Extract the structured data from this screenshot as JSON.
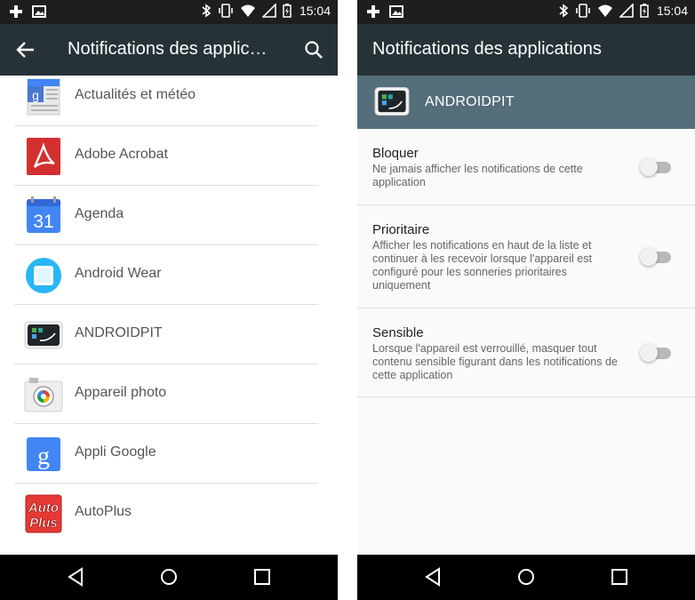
{
  "status_bar": {
    "time": "15:04"
  },
  "left_screen": {
    "title": "Notifications des applic…",
    "apps": [
      {
        "label": "Actualités et météo",
        "icon": "news-weather-icon"
      },
      {
        "label": "Adobe Acrobat",
        "icon": "adobe-acrobat-icon"
      },
      {
        "label": "Agenda",
        "icon": "calendar-icon",
        "icon_text": "31"
      },
      {
        "label": "Android Wear",
        "icon": "android-wear-icon"
      },
      {
        "label": "ANDROIDPIT",
        "icon": "androidpit-icon"
      },
      {
        "label": "Appareil photo",
        "icon": "camera-icon"
      },
      {
        "label": "Appli Google",
        "icon": "google-app-icon",
        "icon_text": "g"
      },
      {
        "label": "AutoPlus",
        "icon": "autoplus-icon",
        "icon_text_1": "Auto",
        "icon_text_2": "Plus"
      }
    ]
  },
  "right_screen": {
    "title": "Notifications des applications",
    "app_name": "ANDROIDPIT",
    "settings": [
      {
        "title": "Bloquer",
        "description": "Ne jamais afficher les notifications de cette application",
        "enabled": false
      },
      {
        "title": "Prioritaire",
        "description": "Afficher les notifications en haut de la liste et continuer à les recevoir lorsque l'appareil est configuré pour les sonneries prioritaires uniquement",
        "enabled": false
      },
      {
        "title": "Sensible",
        "description": "Lorsque l'appareil est verrouillé, masquer tout contenu sensible figurant dans les notifications de cette application",
        "enabled": false
      }
    ]
  },
  "colors": {
    "status_bar": "#1e1e1e",
    "app_bar": "#263238",
    "app_header": "#546e7a",
    "nav_bar": "#000000",
    "toggle_off_track": "#b9b9b9"
  }
}
